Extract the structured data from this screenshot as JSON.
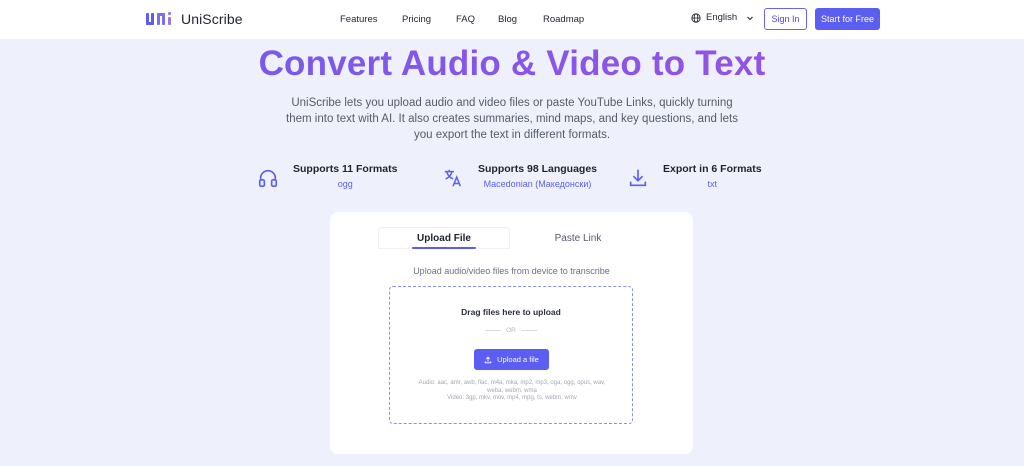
{
  "header": {
    "brand": "UniScribe",
    "nav": [
      "Features",
      "Pricing",
      "FAQ",
      "Blog",
      "Roadmap"
    ],
    "language": "English",
    "sign_in": "Sign In",
    "start_free": "Start for Free"
  },
  "hero": {
    "title": "Convert Audio & Video to Text",
    "description": "UniScribe lets you upload audio and video files or paste YouTube Links, quickly turning them into text with AI. It also creates summaries, mind maps, and key questions, and lets you export the text in different formats."
  },
  "features": [
    {
      "title": "Supports 11 Formats",
      "value": "ogg",
      "icon": "headphones-icon"
    },
    {
      "title": "Supports 98 Languages",
      "value": "Macedonian (Македонски)",
      "icon": "translate-icon"
    },
    {
      "title": "Export in 6 Formats",
      "value": "txt",
      "icon": "download-icon"
    }
  ],
  "upload": {
    "tabs": [
      "Upload File",
      "Paste Link"
    ],
    "active_tab": "Upload File",
    "hint": "Upload audio/video files from device to transcribe",
    "drop_title": "Drag files here to upload",
    "or": "OR",
    "button": "Upload a file",
    "audio_formats": "Audio: aac, amr, awb, flac, m4a, mka, mp2, mp3, oga, ogg, opus, wav, weba, webm, wma",
    "video_formats": "Video: 3gp, mkv, mov, mp4, mpg, ts, webm, wmv"
  },
  "colors": {
    "accent": "#5b5ef0",
    "title_gradient_start": "#6b5cf0",
    "title_gradient_end": "#9a4fe0",
    "background": "#eef1fb"
  }
}
